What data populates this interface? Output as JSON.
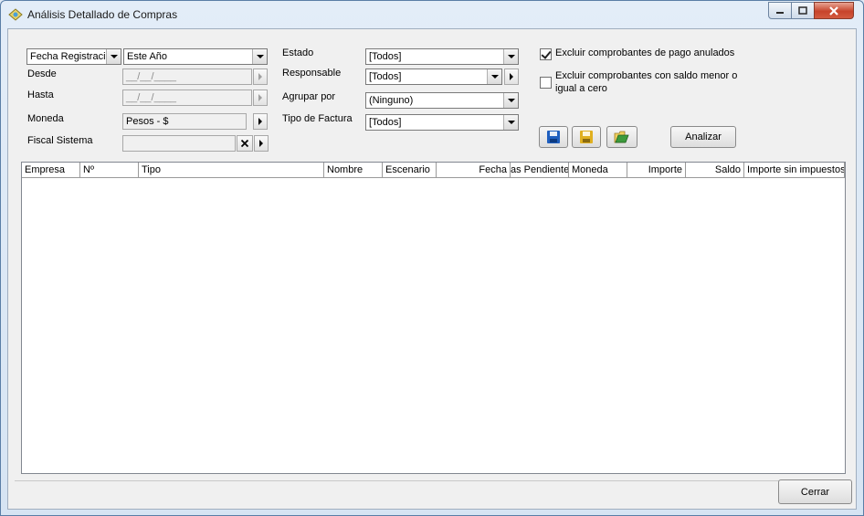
{
  "window": {
    "title": "Análisis Detallado de Compras"
  },
  "filters": {
    "date_type": "Fecha Registraci",
    "period": "Este Año",
    "desde_label": "Desde",
    "desde_value": "__/__/____",
    "hasta_label": "Hasta",
    "hasta_value": "__/__/____",
    "moneda_label": "Moneda",
    "moneda_value": "Pesos - $",
    "fiscal_label": "Fiscal Sistema",
    "estado_label": "Estado",
    "estado_value": "[Todos]",
    "responsable_label": "Responsable",
    "responsable_value": "[Todos]",
    "agrupar_label": "Agrupar por",
    "agrupar_value": "(Ninguno)",
    "tipo_label": "Tipo de Factura",
    "tipo_value": "[Todos]"
  },
  "options": {
    "excluir_anulados": "Excluir comprobantes de pago anulados",
    "excluir_anulados_checked": true,
    "excluir_saldo_line1": "Excluir comprobantes con saldo menor o",
    "excluir_saldo_line2": "igual a cero",
    "excluir_saldo_checked": false
  },
  "actions": {
    "analizar": "Analizar",
    "cerrar": "Cerrar"
  },
  "grid": {
    "columns": [
      "Empresa",
      "Nº",
      "Tipo",
      "Nombre",
      "Escenario",
      "Fecha",
      "as Pendiente",
      "Moneda",
      "Importe",
      "Saldo",
      "Importe sin impuestos"
    ]
  },
  "colors": {
    "accent_save_blue": "#1f5fbf",
    "accent_save_yellow": "#e0b020",
    "accent_open_green": "#3c9a3c"
  }
}
